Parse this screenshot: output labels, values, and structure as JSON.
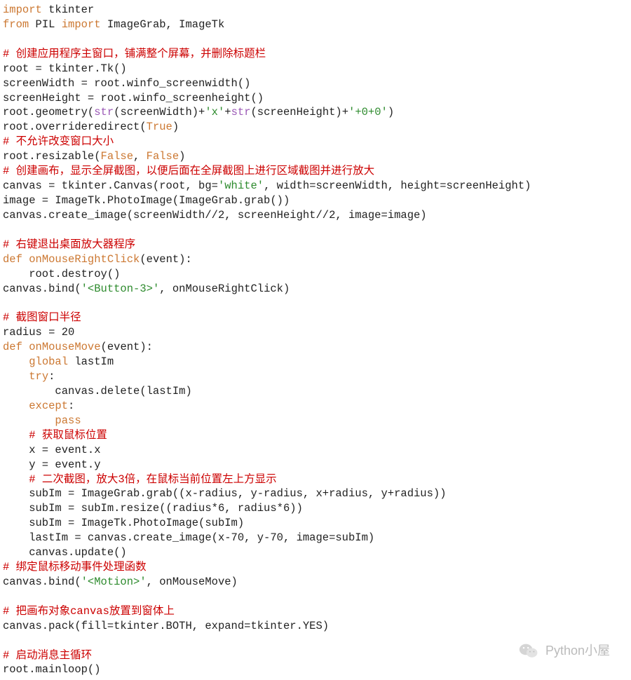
{
  "code_lines": [
    {
      "segs": [
        [
          "kw",
          "import"
        ],
        [
          "plain",
          " tkinter"
        ]
      ]
    },
    {
      "segs": [
        [
          "kw",
          "from"
        ],
        [
          "plain",
          " PIL "
        ],
        [
          "kw",
          "import"
        ],
        [
          "plain",
          " ImageGrab, ImageTk"
        ]
      ]
    },
    {
      "segs": [
        [
          "plain",
          ""
        ]
      ]
    },
    {
      "segs": [
        [
          "cmt",
          "# 创建应用程序主窗口，铺满整个屏幕，并删除标题栏"
        ]
      ]
    },
    {
      "segs": [
        [
          "plain",
          "root = tkinter.Tk()"
        ]
      ]
    },
    {
      "segs": [
        [
          "plain",
          "screenWidth = root.winfo_screenwidth()"
        ]
      ]
    },
    {
      "segs": [
        [
          "plain",
          "screenHeight = root.winfo_screenheight()"
        ]
      ]
    },
    {
      "segs": [
        [
          "plain",
          "root.geometry("
        ],
        [
          "purple",
          "str"
        ],
        [
          "plain",
          "(screenWidth)+"
        ],
        [
          "str",
          "'x'"
        ],
        [
          "plain",
          "+"
        ],
        [
          "purple",
          "str"
        ],
        [
          "plain",
          "(screenHeight)+"
        ],
        [
          "str",
          "'+0+0'"
        ],
        [
          "plain",
          ")"
        ]
      ]
    },
    {
      "segs": [
        [
          "plain",
          "root.overrideredirect("
        ],
        [
          "kw",
          "True"
        ],
        [
          "plain",
          ")"
        ]
      ]
    },
    {
      "segs": [
        [
          "cmt",
          "# 不允许改变窗口大小"
        ]
      ]
    },
    {
      "segs": [
        [
          "plain",
          "root.resizable("
        ],
        [
          "kw",
          "False"
        ],
        [
          "plain",
          ", "
        ],
        [
          "kw",
          "False"
        ],
        [
          "plain",
          ")"
        ]
      ]
    },
    {
      "segs": [
        [
          "cmt",
          "# 创建画布，显示全屏截图，以便后面在全屏截图上进行区域截图并进行放大"
        ]
      ]
    },
    {
      "segs": [
        [
          "plain",
          "canvas = tkinter.Canvas(root, bg="
        ],
        [
          "str",
          "'white'"
        ],
        [
          "plain",
          ", width=screenWidth, height=screenHeight)"
        ]
      ]
    },
    {
      "segs": [
        [
          "plain",
          "image = ImageTk.PhotoImage(ImageGrab.grab())"
        ]
      ]
    },
    {
      "segs": [
        [
          "plain",
          "canvas.create_image(screenWidth//2, screenHeight//2, image=image)"
        ]
      ]
    },
    {
      "segs": [
        [
          "plain",
          ""
        ]
      ]
    },
    {
      "segs": [
        [
          "cmt",
          "# 右键退出桌面放大器程序"
        ]
      ]
    },
    {
      "segs": [
        [
          "kw",
          "def "
        ],
        [
          "kw",
          "onMouseRightClick"
        ],
        [
          "plain",
          "(event):"
        ]
      ]
    },
    {
      "segs": [
        [
          "plain",
          "    root.destroy()"
        ]
      ]
    },
    {
      "segs": [
        [
          "plain",
          "canvas.bind("
        ],
        [
          "str",
          "'<Button-3>'"
        ],
        [
          "plain",
          ", onMouseRightClick)"
        ]
      ]
    },
    {
      "segs": [
        [
          "plain",
          ""
        ]
      ]
    },
    {
      "segs": [
        [
          "cmt",
          "# 截图窗口半径"
        ]
      ]
    },
    {
      "segs": [
        [
          "plain",
          "radius = 20"
        ]
      ]
    },
    {
      "segs": [
        [
          "kw",
          "def "
        ],
        [
          "kw",
          "onMouseMove"
        ],
        [
          "plain",
          "(event):"
        ]
      ]
    },
    {
      "segs": [
        [
          "plain",
          "    "
        ],
        [
          "kw",
          "global"
        ],
        [
          "plain",
          " lastIm"
        ]
      ]
    },
    {
      "segs": [
        [
          "plain",
          "    "
        ],
        [
          "kw",
          "try"
        ],
        [
          "plain",
          ":"
        ]
      ]
    },
    {
      "segs": [
        [
          "plain",
          "        canvas.delete(lastIm)"
        ]
      ]
    },
    {
      "segs": [
        [
          "plain",
          "    "
        ],
        [
          "kw",
          "except"
        ],
        [
          "plain",
          ":"
        ]
      ]
    },
    {
      "segs": [
        [
          "plain",
          "        "
        ],
        [
          "kw",
          "pass"
        ]
      ]
    },
    {
      "segs": [
        [
          "plain",
          "    "
        ],
        [
          "cmt",
          "# 获取鼠标位置"
        ]
      ]
    },
    {
      "segs": [
        [
          "plain",
          "    x = event.x"
        ]
      ]
    },
    {
      "segs": [
        [
          "plain",
          "    y = event.y"
        ]
      ]
    },
    {
      "segs": [
        [
          "plain",
          "    "
        ],
        [
          "cmt",
          "# 二次截图，放大3倍，在鼠标当前位置左上方显示"
        ]
      ]
    },
    {
      "segs": [
        [
          "plain",
          "    subIm = ImageGrab.grab((x-radius, y-radius, x+radius, y+radius))"
        ]
      ]
    },
    {
      "segs": [
        [
          "plain",
          "    subIm = subIm.resize((radius*6, radius*6))"
        ]
      ]
    },
    {
      "segs": [
        [
          "plain",
          "    subIm = ImageTk.PhotoImage(subIm)"
        ]
      ]
    },
    {
      "segs": [
        [
          "plain",
          "    lastIm = canvas.create_image(x-70, y-70, image=subIm)"
        ]
      ]
    },
    {
      "segs": [
        [
          "plain",
          "    canvas.update()"
        ]
      ]
    },
    {
      "segs": [
        [
          "cmt",
          "# 绑定鼠标移动事件处理函数"
        ]
      ]
    },
    {
      "segs": [
        [
          "plain",
          "canvas.bind("
        ],
        [
          "str",
          "'<Motion>'"
        ],
        [
          "plain",
          ", onMouseMove)"
        ]
      ]
    },
    {
      "segs": [
        [
          "plain",
          ""
        ]
      ]
    },
    {
      "segs": [
        [
          "cmt",
          "# 把画布对象canvas放置到窗体上"
        ]
      ]
    },
    {
      "segs": [
        [
          "plain",
          "canvas.pack(fill=tkinter.BOTH, expand=tkinter.YES)"
        ]
      ]
    },
    {
      "segs": [
        [
          "plain",
          ""
        ]
      ]
    },
    {
      "segs": [
        [
          "cmt",
          "# 启动消息主循环"
        ]
      ]
    },
    {
      "segs": [
        [
          "plain",
          "root.mainloop()"
        ]
      ]
    }
  ],
  "watermark_text": "Python小屋"
}
